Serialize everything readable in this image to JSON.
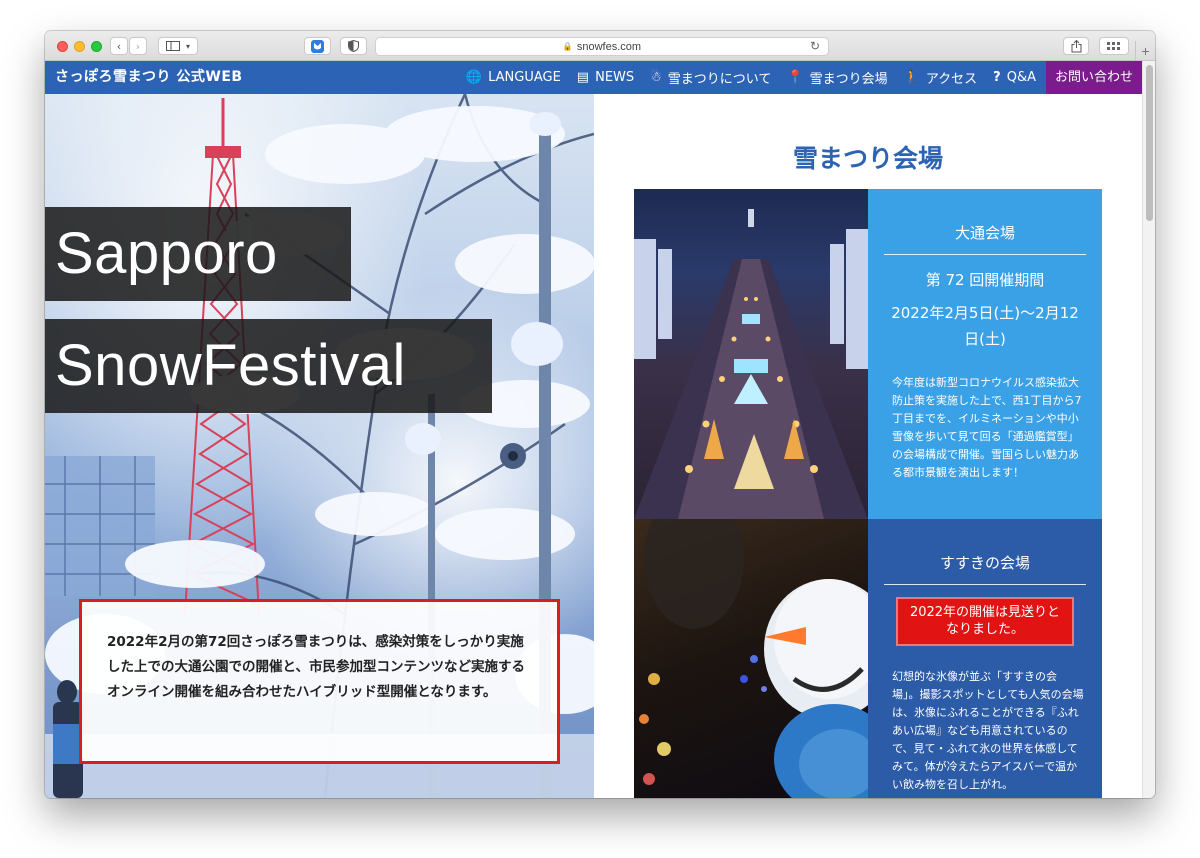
{
  "browser": {
    "url": "snowfes.com",
    "colors": {
      "close": "#fe5f57",
      "minimize": "#febc2e",
      "maximize": "#28c840"
    }
  },
  "site": {
    "title": "さっぽろ雪まつり 公式WEB",
    "nav": [
      {
        "icon": "globe-icon",
        "glyph": "🌐",
        "label": "LANGUAGE"
      },
      {
        "icon": "news-icon",
        "glyph": "▤",
        "label": "NEWS"
      },
      {
        "icon": "snowman-icon",
        "glyph": "☃",
        "label": "雪まつりについて"
      },
      {
        "icon": "map-pin-icon",
        "glyph": "📍",
        "label": "雪まつり会場"
      },
      {
        "icon": "walker-icon",
        "glyph": "🚶",
        "label": "アクセス"
      },
      {
        "icon": "question-icon",
        "glyph": "?",
        "label": "Q&A"
      }
    ],
    "contact_label": "お問い合わせ",
    "colors": {
      "nav_bg": "#2c63b4",
      "contact_bg": "#7a1c8c"
    }
  },
  "hero": {
    "title_line1": "Sapporo",
    "title_line2": "SnowFestival",
    "caption": "2022年2月の第72回さっぽろ雪まつりは、感染対策をしっかり実施した上での大通公園での開催と、市民参加型コンテンツなど実施するオンライン開催を組み合わせたハイブリッド型開催となります。"
  },
  "main": {
    "heading": "雪まつり会場",
    "venues": [
      {
        "name": "大通会場",
        "period_label": "第 72 回開催期間",
        "period_date": "2022年2月5日(土)〜2月12日(土)",
        "description": "今年度は新型コロナウイルス感染拡大防止策を実施した上で、西1丁目から7丁目までを、イルミネーションや中小雪像を歩いて見て回る「通過鑑賞型」の会場構成で開催。雪国らしい魅力ある都市景観を演出します！",
        "color": "#3ba1e6"
      },
      {
        "name": "すすきの会場",
        "notice": "2022年の開催は見送りとなりました。",
        "description": "幻想的な氷像が並ぶ「すすきの会場」。撮影スポットとしても人気の会場は、氷像にふれることができる『ふれあい広場』なども用意されているので、見て・ふれて氷の世界を体感してみて。体が冷えたらアイスバーで温かい飲み物を召し上がれ。",
        "color": "#2c5ba8"
      }
    ]
  }
}
